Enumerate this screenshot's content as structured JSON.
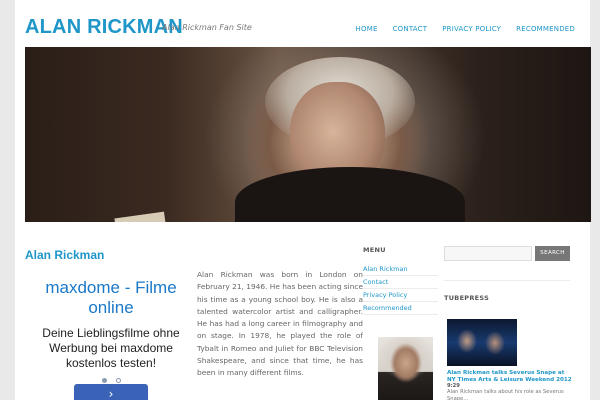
{
  "header": {
    "site_title": "ALAN RICKMAN",
    "tagline": "Alan Rickman Fan Site",
    "nav": [
      "HOME",
      "CONTACT",
      "PRIVACY POLICY",
      "RECOMMENDED"
    ]
  },
  "main": {
    "page_title": "Alan Rickman",
    "ad": {
      "heading": "maxdome - Filme online",
      "text": "Deine Lieblingsfilme ohne Werbung bei maxdome kostenlos testen!",
      "button_icon": "chevron-right-icon",
      "button_glyph": "›"
    },
    "article_body": "Alan Rickman was born in London on February 21, 1946. He has been acting since his time as a young school boy. He is also a talented watercolor artist and calligrapher. He has had a long career in filmography and on stage. In 1978, he played the role of Tybalt in Romeo and Juliet for BBC Television Shakespeare, and since that time, he has been in many different films."
  },
  "sidebar": {
    "menu_title": "MENU",
    "menu_items": [
      "Alan Rickman",
      "Contact",
      "Privacy Policy",
      "Recommended"
    ],
    "search_button": "SEARCH",
    "tubepress_title": "TUBEPRESS",
    "video": {
      "title": "Alan Rickman talks Severus Snape at NY Times Arts & Leisure Weekend 2012",
      "duration": "9:29",
      "description": "Alan Rickman talks about his role as Severus Snape..."
    }
  },
  "colors": {
    "accent": "#1e96c8",
    "ad_button": "#3a63b8",
    "search_button": "#777777"
  }
}
